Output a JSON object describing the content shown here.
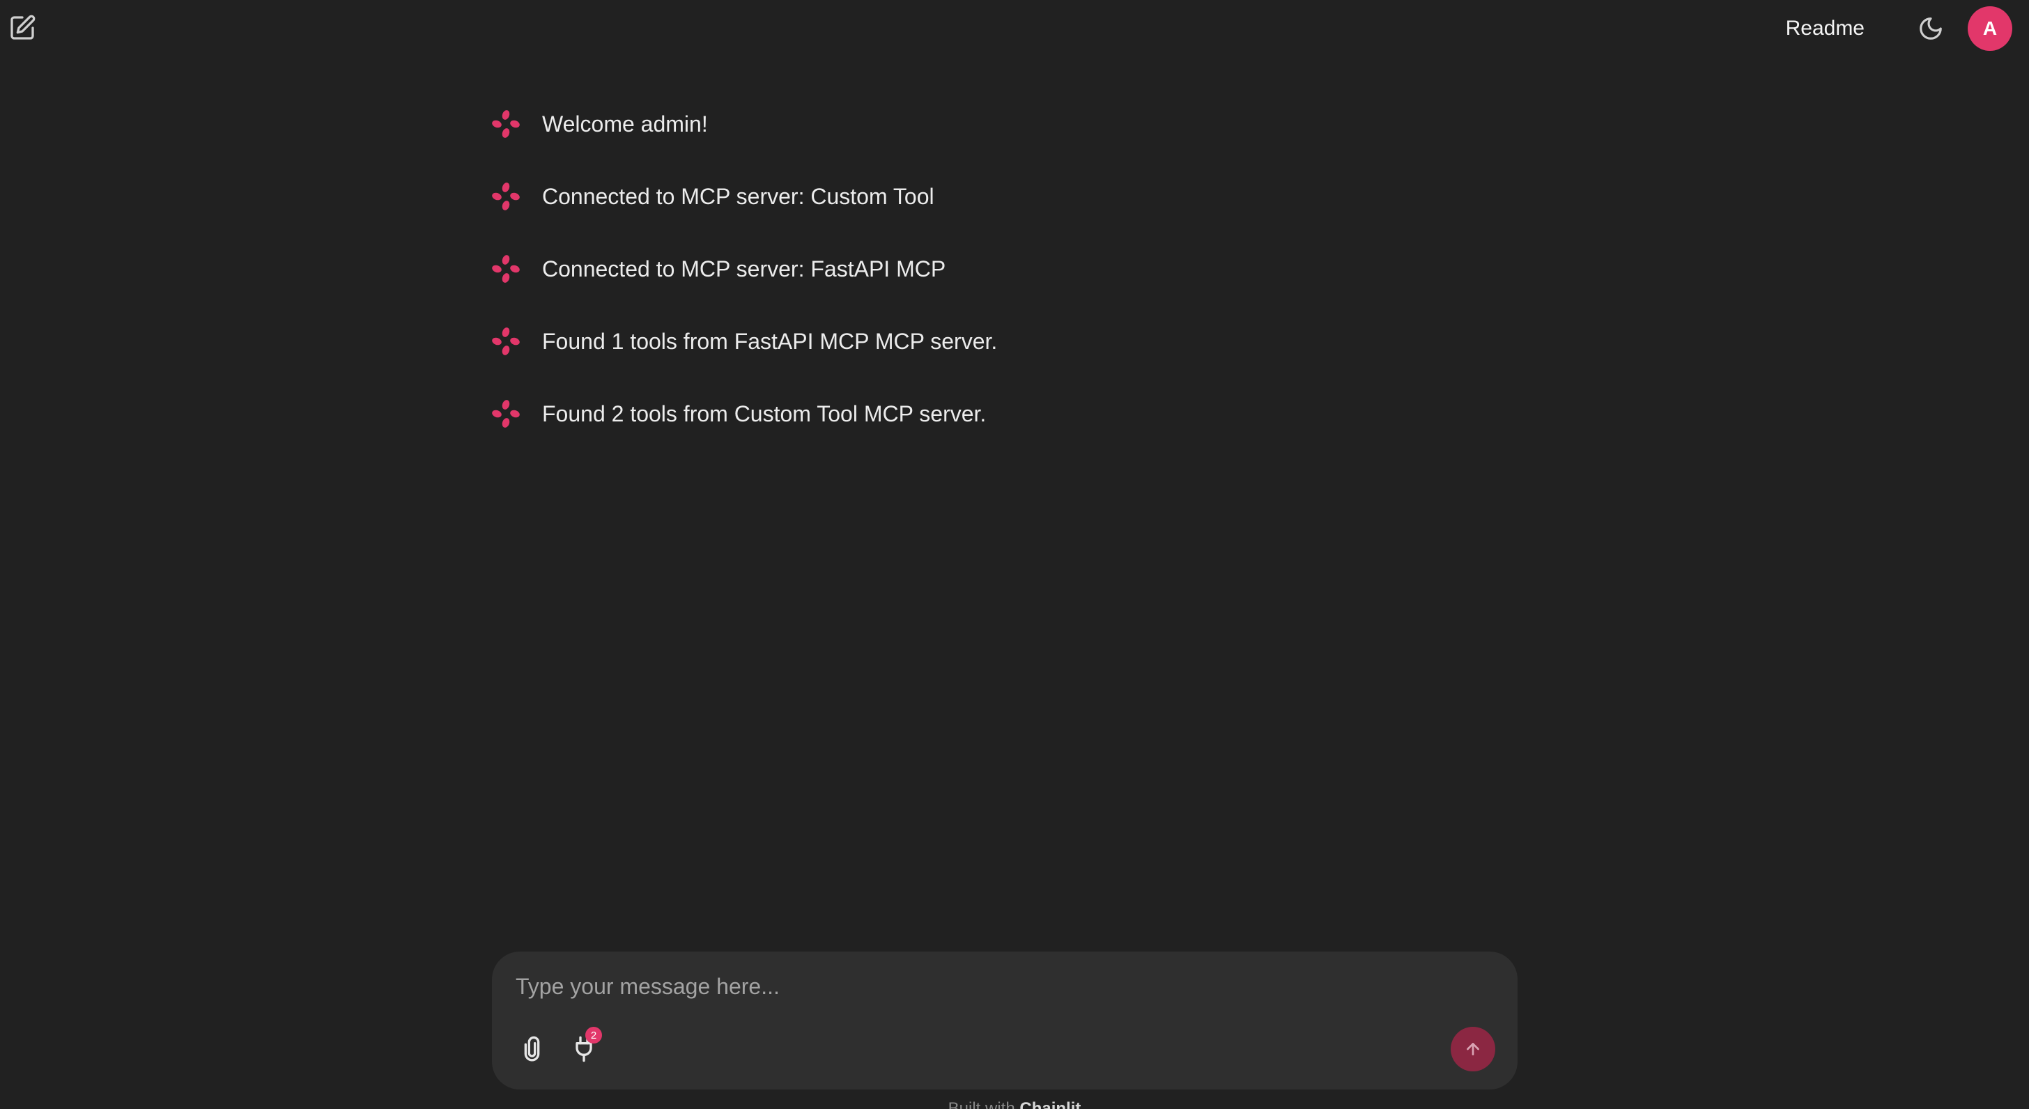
{
  "header": {
    "new_chat_icon": "edit-icon",
    "readme_label": "Readme",
    "theme_icon": "moon-icon",
    "avatar_initial": "A"
  },
  "messages": [
    {
      "icon": "chainlit-logo-icon",
      "text": "Welcome admin!"
    },
    {
      "icon": "chainlit-logo-icon",
      "text": "Connected to MCP server: Custom Tool"
    },
    {
      "icon": "chainlit-logo-icon",
      "text": "Connected to MCP server: FastAPI MCP"
    },
    {
      "icon": "chainlit-logo-icon",
      "text": "Found 1 tools from FastAPI MCP MCP server."
    },
    {
      "icon": "chainlit-logo-icon",
      "text": "Found 2 tools from Custom Tool MCP server."
    }
  ],
  "composer": {
    "placeholder": "Type your message here...",
    "value": "",
    "attach_icon": "paperclip-icon",
    "plugin_icon": "plug-icon",
    "plugin_badge": "2",
    "send_icon": "arrow-up-icon"
  },
  "footer": {
    "prefix": "Built with",
    "brand": "Chainlit"
  },
  "colors": {
    "background": "#212121",
    "composer": "#2f2f2f",
    "accent": "#e2376a",
    "send_button": "#8b2742"
  }
}
